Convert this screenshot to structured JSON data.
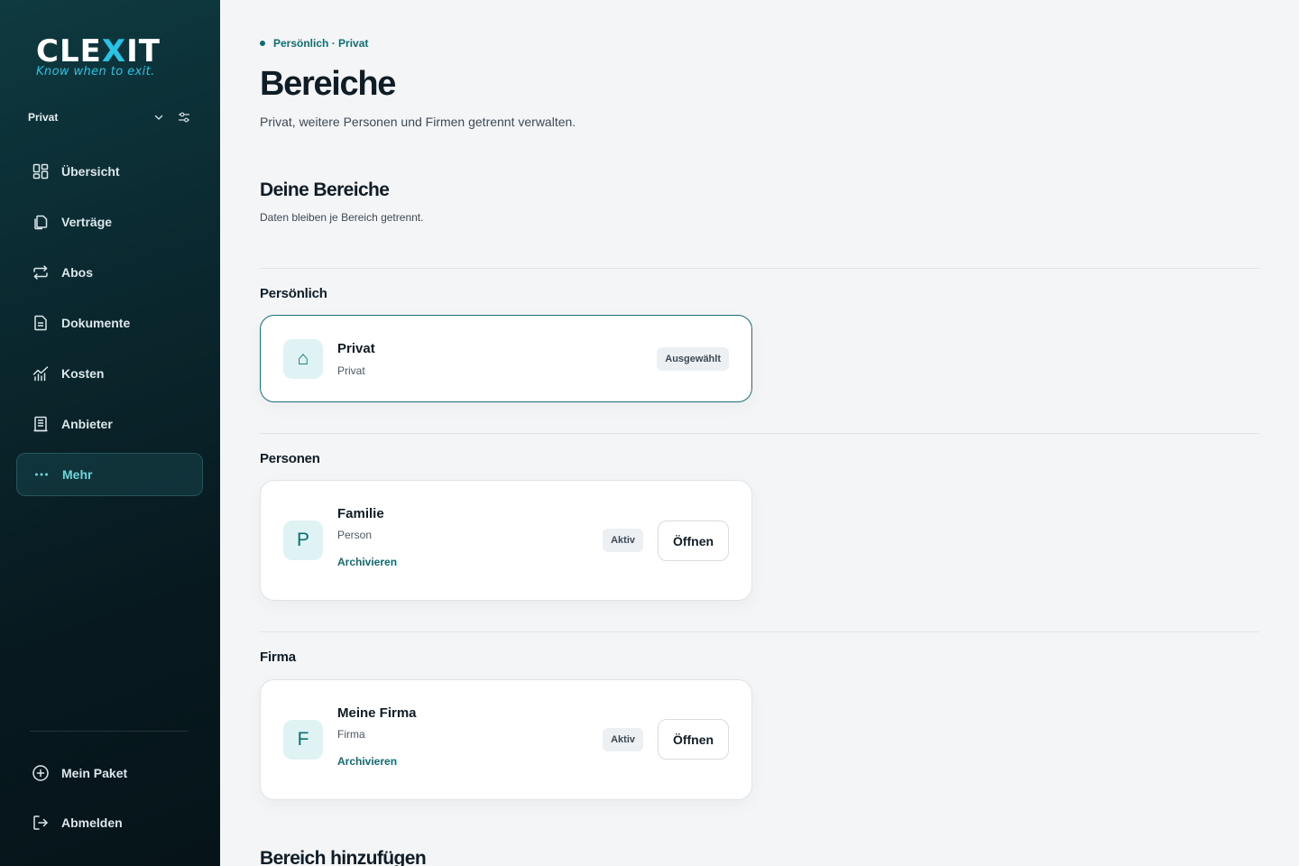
{
  "brand": {
    "name_part1": "CLE",
    "name_x": "X",
    "name_part2": "IT",
    "tagline": "Know when to exit."
  },
  "scope": {
    "label": "Privat",
    "chevron_icon": "chevron-down-icon",
    "filter_icon": "sliders-icon"
  },
  "sidebar": {
    "items": [
      {
        "label": "Übersicht",
        "icon": "dashboard-icon"
      },
      {
        "label": "Verträge",
        "icon": "copy-icon"
      },
      {
        "label": "Abos",
        "icon": "repeat-icon"
      },
      {
        "label": "Dokumente",
        "icon": "document-icon"
      },
      {
        "label": "Kosten",
        "icon": "chart-icon"
      },
      {
        "label": "Anbieter",
        "icon": "building-icon"
      },
      {
        "label": "Mehr",
        "icon": "more-icon",
        "active": true
      }
    ],
    "bottom": [
      {
        "label": "Mein Paket",
        "icon": "plus-circle-icon"
      },
      {
        "label": "Abmelden",
        "icon": "logout-icon"
      }
    ]
  },
  "header": {
    "breadcrumb": "Persönlich · Privat",
    "title": "Bereiche",
    "subtitle": "Privat, weitere Personen und Firmen getrennt verwalten."
  },
  "section": {
    "title": "Deine Bereiche",
    "subtitle": "Daten bleiben je Bereich getrennt."
  },
  "groups": {
    "personal": {
      "title": "Persönlich",
      "card": {
        "avatar": "⌂",
        "name": "Privat",
        "type": "Privat",
        "badge": "Ausgewählt"
      }
    },
    "persons": {
      "title": "Personen",
      "card": {
        "avatar": "P",
        "name": "Familie",
        "type": "Person",
        "archive": "Archivieren",
        "badge": "Aktiv",
        "open": "Öffnen"
      }
    },
    "company": {
      "title": "Firma",
      "card": {
        "avatar": "F",
        "name": "Meine Firma",
        "type": "Firma",
        "archive": "Archivieren",
        "badge": "Aktiv",
        "open": "Öffnen"
      }
    }
  },
  "add_section": {
    "title": "Bereich hinzufügen"
  },
  "colors": {
    "accent": "#0e6d72",
    "sidebar_bg": "#0b2a31",
    "highlight": "#27c4e6"
  }
}
